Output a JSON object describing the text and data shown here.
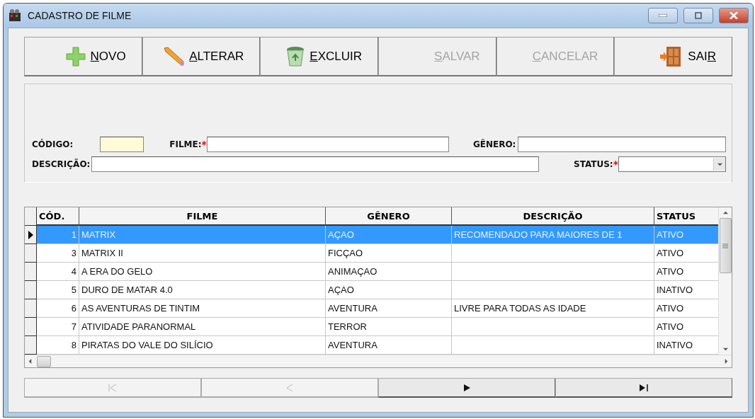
{
  "window": {
    "title": "CADASTRO DE FILME"
  },
  "toolbar": [
    {
      "kind": "add",
      "key": "N",
      "after": "OVO",
      "disabled": false
    },
    {
      "kind": "edit",
      "key": "A",
      "after": "LTERAR",
      "disabled": false
    },
    {
      "kind": "delete",
      "key": "E",
      "after": "XCLUIR",
      "disabled": false
    },
    {
      "kind": "save",
      "key": "S",
      "after": "ALVAR",
      "disabled": true
    },
    {
      "kind": "cancel",
      "key": "C",
      "after": "ANCELAR",
      "disabled": true
    },
    {
      "kind": "exit",
      "before": "SAI",
      "key": "R",
      "disabled": false
    }
  ],
  "form": {
    "codigo": {
      "label": "CÓDIGO:"
    },
    "filme": {
      "label": "FILME:",
      "required_mark": "*"
    },
    "genero": {
      "label": "GÊNERO:"
    },
    "descricao": {
      "label": "DESCRIÇÃO:"
    },
    "status": {
      "label": "STATUS:",
      "required_mark": "*"
    }
  },
  "table": {
    "columns": [
      "CÓD.",
      "FILME",
      "GÊNERO",
      "DESCRIÇÃO",
      "STATUS"
    ],
    "rows": [
      {
        "selected": true,
        "cells": [
          "1",
          "MATRIX",
          "AÇAO",
          "RECOMENDADO PARA MAIORES DE 1",
          "ATIVO"
        ]
      },
      {
        "selected": false,
        "cells": [
          "3",
          "MATRIX II",
          "FICÇAO",
          "",
          "ATIVO"
        ]
      },
      {
        "selected": false,
        "cells": [
          "4",
          "A ERA DO GELO",
          "ANIMAÇAO",
          "",
          "ATIVO"
        ]
      },
      {
        "selected": false,
        "cells": [
          "5",
          "DURO DE MATAR 4.0",
          "AÇAO",
          "",
          "INATIVO"
        ]
      },
      {
        "selected": false,
        "cells": [
          "6",
          "AS AVENTURAS DE TINTIM",
          "AVENTURA",
          "LIVRE PARA TODAS AS IDADE",
          "ATIVO"
        ]
      },
      {
        "selected": false,
        "cells": [
          "7",
          "ATIVIDADE PARANORMAL",
          "TERROR",
          "",
          "ATIVO"
        ]
      },
      {
        "selected": false,
        "cells": [
          "8",
          "PIRATAS DO VALE DO SILÍCIO",
          "AVENTURA",
          "",
          "INATIVO"
        ]
      }
    ]
  },
  "navigator": [
    {
      "kind": "first",
      "disabled": true
    },
    {
      "kind": "prior",
      "disabled": true
    },
    {
      "kind": "next",
      "disabled": false
    },
    {
      "kind": "last",
      "disabled": false
    }
  ]
}
